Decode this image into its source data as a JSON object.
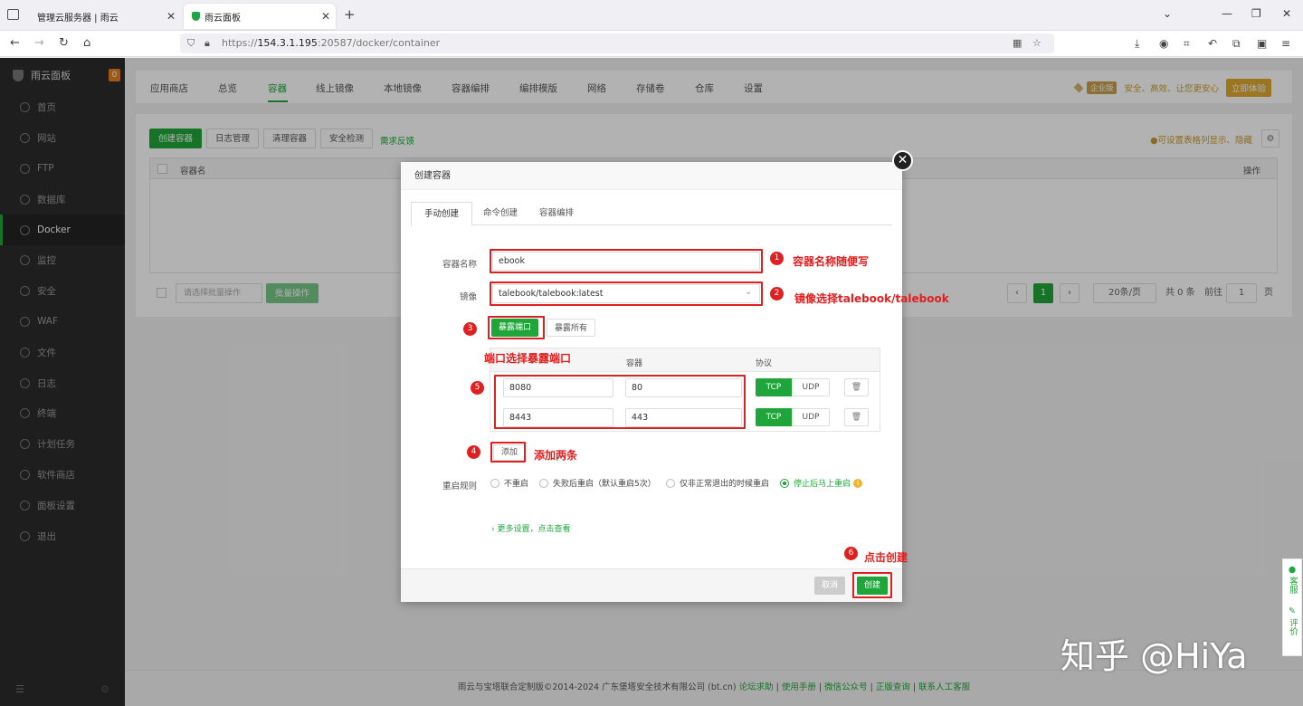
{
  "browser": {
    "tabs": [
      {
        "label": "管理云服务器 | 雨云"
      },
      {
        "label": "雨云面板"
      }
    ],
    "url_prefix": "https://",
    "url_host": "154.3.1.195",
    "url_path": ":20587/docker/container"
  },
  "sidebar": {
    "brand": "雨云面板",
    "badge": "0",
    "items": [
      {
        "label": "首页"
      },
      {
        "label": "网站"
      },
      {
        "label": "FTP"
      },
      {
        "label": "数据库"
      },
      {
        "label": "Docker"
      },
      {
        "label": "监控"
      },
      {
        "label": "安全"
      },
      {
        "label": "WAF"
      },
      {
        "label": "文件"
      },
      {
        "label": "日志"
      },
      {
        "label": "终端"
      },
      {
        "label": "计划任务"
      },
      {
        "label": "软件商店"
      },
      {
        "label": "面板设置"
      },
      {
        "label": "退出"
      }
    ]
  },
  "topnav": {
    "items": [
      "应用商店",
      "总览",
      "容器",
      "线上镜像",
      "本地镜像",
      "容器编排",
      "编排模版",
      "网络",
      "存储卷",
      "仓库",
      "设置"
    ],
    "promo_tag": "企业版",
    "promo_text": "安全、高效、让您更安心",
    "promo_btn": "立即体验"
  },
  "toolbar": {
    "create": "创建容器",
    "logs": "日志管理",
    "clean": "清理容器",
    "security": "安全检测",
    "feedback": "需求反馈",
    "hint": "可设置表格列显示、隐藏"
  },
  "table": {
    "col_name": "容器名",
    "col_action": "操作",
    "batch_placeholder": "请选择批量操作",
    "batch_btn": "批量操作"
  },
  "pager": {
    "page": "1",
    "size": "20条/页",
    "total": "共 0 条",
    "goto_label": "前往",
    "goto_value": "1",
    "page_suffix": "页"
  },
  "modal": {
    "title": "创建容器",
    "tabs": [
      "手动创建",
      "命令创建",
      "容器编排"
    ],
    "name_label": "容器名称",
    "name_value": "ebook",
    "image_label": "镜像",
    "image_value": "talebook/talebook:latest",
    "expose_btn": "暴露端口",
    "expose_all_btn": "暴露所有",
    "port_col_container": "容器",
    "port_col_protocol": "协议",
    "ports": [
      {
        "host": "8080",
        "container": "80"
      },
      {
        "host": "8443",
        "container": "443"
      }
    ],
    "tcp": "TCP",
    "udp": "UDP",
    "add_btn": "添加",
    "restart_label": "重启规则",
    "restart_options": [
      "不重启",
      "失败后重启（默认重启5次）",
      "仅非正常退出的时候重启",
      "停止后马上重启"
    ],
    "more": "更多设置，点击查看",
    "cancel": "取消",
    "create": "创建"
  },
  "annotations": {
    "n1": "1",
    "t1": "容器名称随便写",
    "n2": "2",
    "t2": "镜像选择talebook/talebook",
    "n3": "3",
    "t3": "端口选择暴露端口",
    "n4": "4",
    "t4": "添加两条",
    "n5": "5",
    "n6": "6",
    "t6": "点击创建"
  },
  "footer": {
    "copyright": "雨云与宝塔联合定制版©2014-2024 广东堡塔安全技术有限公司 (bt.cn)",
    "links": [
      "论坛求助",
      "使用手册",
      "微信公众号",
      "正版查询",
      "联系人工客服"
    ]
  },
  "float": {
    "service": "客服",
    "review": "评价"
  },
  "watermark": "知乎 @HiYa"
}
